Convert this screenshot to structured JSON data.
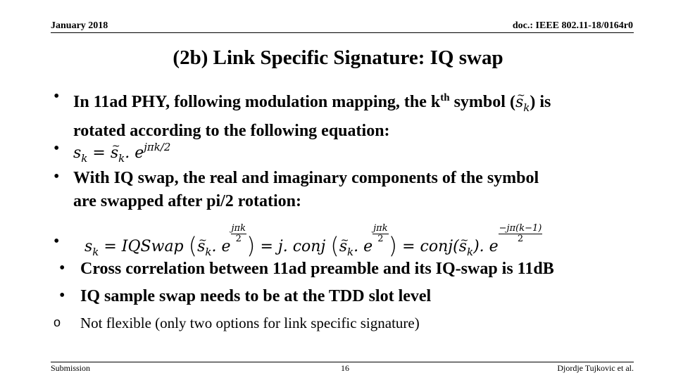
{
  "header": {
    "date": "January 2018",
    "doc_id": "doc.: IEEE 802.11-18/0164r0"
  },
  "title": "(2b) Link Specific Signature: IQ swap",
  "body": {
    "bullets": [
      {
        "type": "text",
        "line1_a": "In 11ad PHY, following modulation mapping, the k",
        "line1_sup": "th",
        "line1_b": " symbol (",
        "line1_sym": "s",
        "line1_sym_sub": "k",
        "line1_c": ") is",
        "line2": "rotated according to the following equation:"
      },
      {
        "type": "equation",
        "lhs": "s",
        "lhs_sub": "k",
        "eq": " = ",
        "rhs_sym": "s",
        "rhs_sub": "k",
        "dot_e": ". e",
        "exponent": "jπk/2"
      },
      {
        "type": "text",
        "line1": "With IQ swap, the real and imaginary components of the symbol",
        "line2": "are swapped after pi/2 rotation:"
      },
      {
        "type": "equation",
        "lhs": "s",
        "lhs_sub": "k",
        "eq1": " = IQSwap",
        "sym1": "s",
        "sub1": "k",
        "dot_e1": ". e",
        "frac1_num": "jπk",
        "frac1_den": "2",
        "eq2": " = j. conj",
        "sym2": "s",
        "sub2": "k",
        "dot_e2": ". e",
        "frac2_num": "jπk",
        "frac2_den": "2",
        "eq3": " = conj(",
        "sym3": "s",
        "sub3": "k",
        "close3": "). e",
        "frac3_num": "−jπ(k−1)",
        "frac3_den": "2"
      },
      {
        "type": "text",
        "line1": "Cross correlation between 11ad preamble and its IQ-swap is 11dB"
      },
      {
        "type": "text",
        "line1": "IQ sample swap needs to be at the TDD slot level"
      }
    ],
    "sub_bullet": "Not flexible (only two options for link specific signature)",
    "bullet_glyph": "•",
    "sub_bullet_glyph": "o",
    "paren_open": "(",
    "paren_close": ")"
  },
  "footer": {
    "left": "Submission",
    "page_number": "16",
    "author": "Djordje Tujkovic et al."
  }
}
